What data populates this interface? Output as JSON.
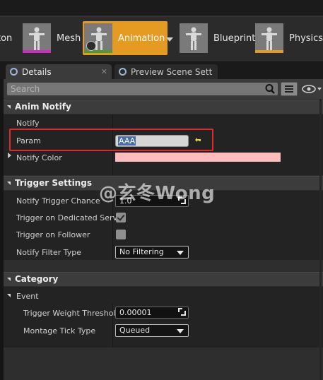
{
  "toolbar": {
    "modes": [
      {
        "label": "eton",
        "accent": null
      },
      {
        "label": "Mesh",
        "accent": "#d12cc7"
      },
      {
        "label": "Animation",
        "accent": "#4a9a3a"
      },
      {
        "label": "Blueprint",
        "accent": null
      },
      {
        "label": "Physics",
        "accent": "#e59a22"
      }
    ],
    "active_mode": "Animation",
    "active_color": "#e59a22"
  },
  "tabs": [
    {
      "label": "Details",
      "icon": "info-icon",
      "active": true
    },
    {
      "label": "Preview Scene Sett",
      "icon": "info-icon",
      "active": false
    }
  ],
  "search": {
    "placeholder": "Search"
  },
  "sections": {
    "anim_notify": {
      "title": "Anim Notify",
      "group_label": "Notify",
      "param_label": "Param",
      "param_value": "AAA",
      "notify_color_label": "Notify Color",
      "notify_color": "#ffbcbc"
    },
    "trigger_settings": {
      "title": "Trigger Settings",
      "chance_label": "Notify Trigger Chance",
      "chance_value": "1.0",
      "dedicated_label": "Trigger on Dedicated Serve",
      "dedicated_checked": true,
      "follower_label": "Trigger on Follower",
      "follower_checked": false,
      "filter_label": "Notify Filter Type",
      "filter_value": "No Filtering"
    },
    "category": {
      "title": "Category",
      "event_label": "Event",
      "weight_label": "Trigger Weight Threshold",
      "weight_value": "0.00001",
      "tick_label": "Montage Tick Type",
      "tick_value": "Queued"
    }
  },
  "watermark": "@玄冬Wong",
  "colors": {
    "highlight_box": "#e02a2a",
    "accent": "#e59a22"
  }
}
